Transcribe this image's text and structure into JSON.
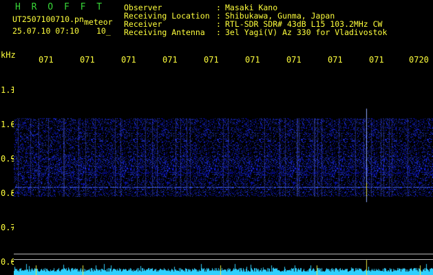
{
  "header": {
    "program": "H R O F F T",
    "filename": "UT2507100710.pn",
    "meteor_label": "meteor",
    "datetime": "25.07.10 07:10",
    "frame": "10_"
  },
  "info": [
    {
      "label": "Observer",
      "sep": ":",
      "value": "Masaki Kano"
    },
    {
      "label": "Receiving Location",
      "sep": ":",
      "value": "Shibukawa, Gunma, Japan"
    },
    {
      "label": "Receiver",
      "sep": ":",
      "value": "RTL-SDR SDR# 43dB L15 103.2MHz CW"
    },
    {
      "label": "Receiving Antenna",
      "sep": ":",
      "value": "3el Yagi(V) Az 330 for Vladivostok"
    }
  ],
  "axes": {
    "y_unit": "kHz",
    "y_ticks": [
      "1.1",
      "1.0",
      "0.9",
      "0.8",
      "0.7",
      "0.6"
    ],
    "x_ticks": [
      "071",
      "071",
      "071",
      "071",
      "071",
      "071",
      "071",
      "071",
      "071",
      "0720"
    ]
  },
  "colors": {
    "text": "#ffff3c",
    "title": "#38d838",
    "signal": "#3050ff",
    "noise_floor": "#30d0ff"
  },
  "spectrogram": {
    "band_kHz": [
      0.8,
      1.0
    ],
    "carrier_kHz": 0.81,
    "meteor_echo_time_fraction": 0.84
  }
}
